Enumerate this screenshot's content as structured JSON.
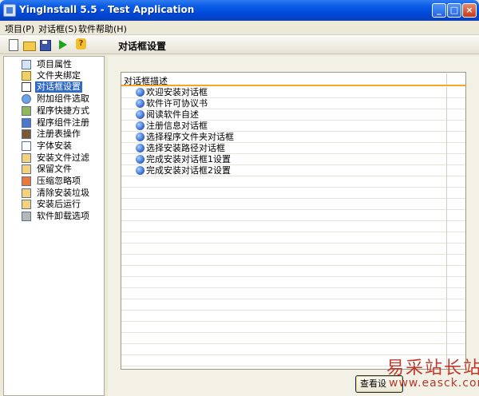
{
  "window": {
    "title": "YingInstall 5.5 - Test Application"
  },
  "menu": {
    "items": [
      "项目(P)",
      "对话框(S)",
      "软件帮助(H)"
    ]
  },
  "toolbar": {
    "icons": [
      "new-icon",
      "open-icon",
      "save-icon",
      "run-icon",
      "help-icon"
    ],
    "title": "对话框设置"
  },
  "sidebar": {
    "items": [
      {
        "label": "项目属性"
      },
      {
        "label": "文件夹绑定"
      },
      {
        "label": "对话框设置",
        "selected": true
      },
      {
        "label": "附加组件选取"
      },
      {
        "label": "程序快捷方式"
      },
      {
        "label": "程序组件注册"
      },
      {
        "label": "注册表操作"
      },
      {
        "label": "字体安装"
      },
      {
        "label": "安装文件过滤"
      },
      {
        "label": "保留文件"
      },
      {
        "label": "压缩忽略项"
      },
      {
        "label": "清除安装垃圾"
      },
      {
        "label": "安装后运行"
      },
      {
        "label": "软件卸载选项"
      }
    ]
  },
  "dialog_list": {
    "header": "对话框描述",
    "items": [
      "欢迎安装对话框",
      "软件许可协议书",
      "阅读软件自述",
      "注册信息对话框",
      "选择程序文件夹对话框",
      "选择安装路径对话框",
      "完成安装对话框1设置",
      "完成安装对话框2设置"
    ]
  },
  "buttons": {
    "view": "查看设"
  },
  "watermark": {
    "text": "易采站长站",
    "url": "www.easck.com"
  }
}
